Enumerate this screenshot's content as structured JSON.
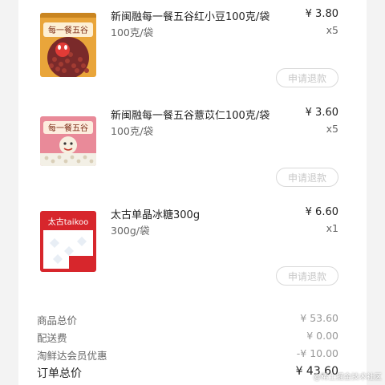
{
  "order_items": [
    {
      "name": "新闽融每一餐五谷红小豆100克/袋",
      "spec": "100克/袋",
      "price": "¥ 3.80",
      "quantity": "x5",
      "refund_label": "申请退款",
      "image_icon": "red-bean-package-icon",
      "package_text": "每一餐五谷"
    },
    {
      "name": "新闽融每一餐五谷薏苡仁100克/袋",
      "spec": "100克/袋",
      "price": "¥ 3.60",
      "quantity": "x5",
      "refund_label": "申请退款",
      "image_icon": "barley-package-icon",
      "package_text": "每一餐五谷"
    },
    {
      "name": "太古单晶冰糖300g",
      "spec": "300g/袋",
      "price": "¥ 6.60",
      "quantity": "x1",
      "refund_label": "申请退款",
      "image_icon": "rock-sugar-package-icon",
      "package_text": "太古taikoo"
    }
  ],
  "summary": {
    "goods_total_label": "商品总价",
    "goods_total_value": "¥ 53.60",
    "delivery_label": "配送费",
    "delivery_value": "¥ 0.00",
    "member_discount_label": "淘鲜达会员优惠",
    "member_discount_value": "-¥ 10.00",
    "order_total_label": "订单总价",
    "order_total_value": "¥ 43.60"
  },
  "watermark": "@稀土掘金技术社区",
  "colors": {
    "background": "#f3f3f3",
    "card": "#ffffff",
    "button_border": "#d9d9d9",
    "button_text": "#c8c8c8",
    "package_orange": "#e9a53a",
    "package_pink": "#e98a99",
    "package_red": "#d7262c"
  }
}
